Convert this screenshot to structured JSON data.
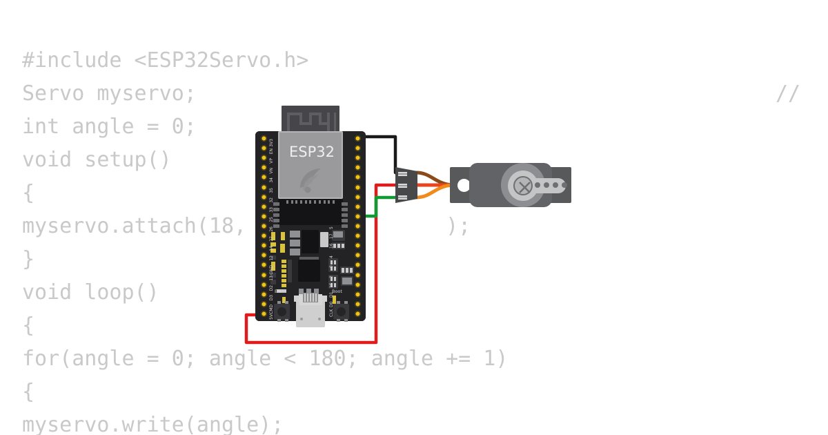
{
  "page": {
    "background": "#ffffff",
    "code_text_color": "#c9c9c9"
  },
  "code": {
    "lines": [
      "#include <ESP32Servo.h>",
      "Servo myservo;",
      "int angle = 0;",
      "void setup()",
      "{",
      "myservo.attach(18,                );",
      "}",
      "void loop()",
      "{",
      "for(angle = 0; angle < 180; angle += 1)",
      "{",
      "myservo.write(angle);"
    ],
    "trailing_comment": "//"
  },
  "board": {
    "name": "esp32-devkit",
    "module_label": "ESP32",
    "button_en_label": "EN",
    "button_boot_label": "Boot",
    "pcb_color": "#232326",
    "pin_color": "#f2c316",
    "pins_left": [
      "3V3",
      "EN",
      "VP",
      "VN",
      "34",
      "35",
      "32",
      "33",
      "25",
      "26",
      "27",
      "14",
      "12",
      "GND",
      "13",
      "D2",
      "D3",
      "CMD",
      "5V"
    ],
    "pins_right": [
      "GND",
      "23",
      "22",
      "TX",
      "RX",
      "21",
      "GND",
      "19",
      "18",
      "5",
      "17",
      "16",
      "4",
      "0",
      "2",
      "15",
      "D1",
      "D0",
      "CLK"
    ]
  },
  "servo": {
    "name": "micro-servo",
    "body_color": "#626366",
    "horn_color": "#c4c5c7",
    "tab_color": "#58595b"
  },
  "wires": [
    {
      "name": "gnd-wire",
      "color": "#1a1a1a",
      "from_pin": "GND",
      "to_terminal": "ground"
    },
    {
      "name": "power-wire",
      "color": "#e01b1b",
      "from_pin": "5V",
      "to_terminal": "power"
    },
    {
      "name": "signal-wire",
      "color": "#0f9b33",
      "from_pin": "18",
      "to_terminal": "signal"
    }
  ],
  "servo_leads": [
    {
      "name": "lead-brown",
      "color": "#8a4a1a"
    },
    {
      "name": "lead-red",
      "color": "#e8441e"
    },
    {
      "name": "lead-orange",
      "color": "#f08a1c"
    }
  ]
}
